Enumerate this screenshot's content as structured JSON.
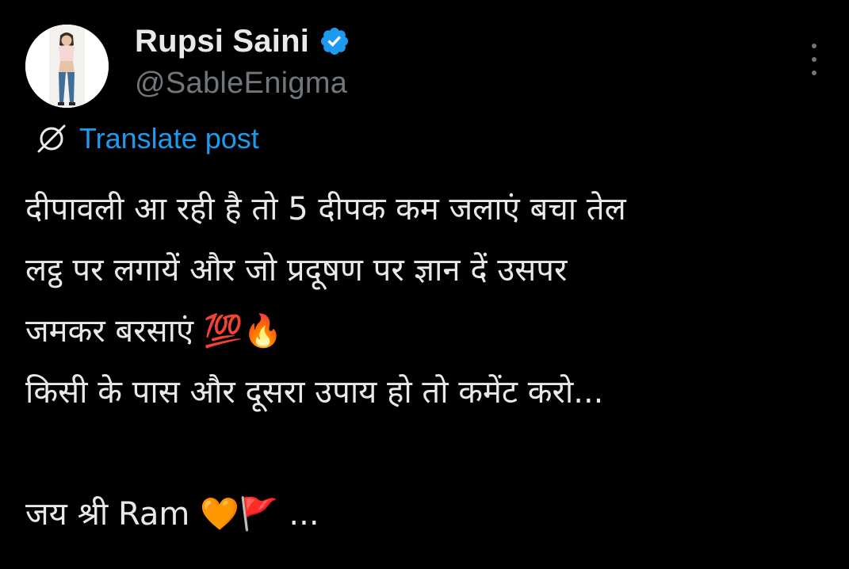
{
  "author": {
    "display_name": "Rupsi Saini",
    "handle": "@SableEnigma",
    "verified": true
  },
  "translate_label": "Translate post",
  "post_lines": [
    "दीपावली आ रही है तो 5 दीपक कम जलाएं बचा तेल",
    "लट्ठ पर लगायें और जो प्रदूषण पर ज्ञान दें उसपर",
    "जमकर बरसाएं 💯🔥",
    "किसी के पास और दूसरा उपाय हो तो कमेंट करो...",
    "",
    "जय श्री Ram 🧡🚩 ..."
  ],
  "icons": {
    "verified": "verified-badge-icon",
    "translate": "translate-icon",
    "more": "more-vertical-icon"
  },
  "colors": {
    "background": "#000000",
    "primary_text": "#e7e9ea",
    "secondary_text": "#71767b",
    "accent": "#1d9bf0"
  }
}
